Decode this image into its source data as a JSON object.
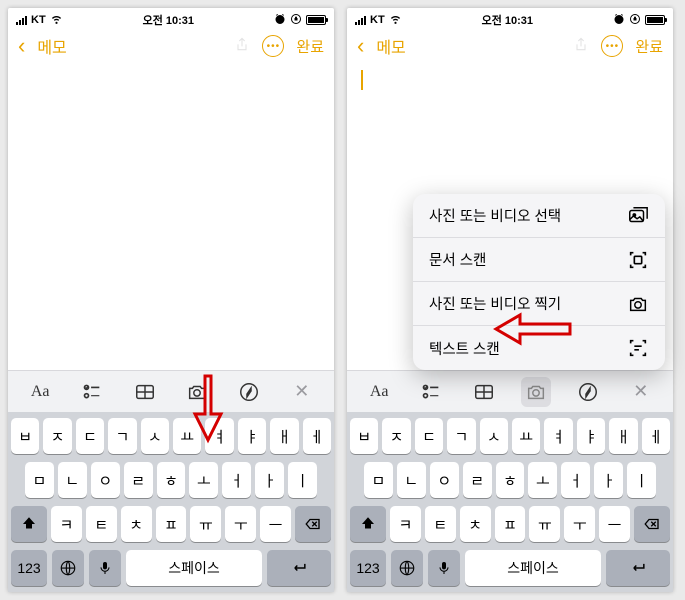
{
  "status": {
    "carrier": "KT",
    "time": "오전 10:31"
  },
  "nav": {
    "back_label": "메모",
    "done_label": "완료"
  },
  "toolbar": {
    "aa": "Aa"
  },
  "popup": {
    "items": [
      {
        "label": "사진 또는 비디오 선택"
      },
      {
        "label": "문서 스캔"
      },
      {
        "label": "사진 또는 비디오 찍기"
      },
      {
        "label": "텍스트 스캔"
      }
    ]
  },
  "keyboard": {
    "row1": [
      "ㅂ",
      "ㅈ",
      "ㄷ",
      "ㄱ",
      "ㅅ",
      "ㅛ",
      "ㅕ",
      "ㅑ",
      "ㅐ",
      "ㅔ"
    ],
    "row2": [
      "ㅁ",
      "ㄴ",
      "ㅇ",
      "ㄹ",
      "ㅎ",
      "ㅗ",
      "ㅓ",
      "ㅏ",
      "ㅣ"
    ],
    "row3": [
      "ㅋ",
      "ㅌ",
      "ㅊ",
      "ㅍ",
      "ㅠ",
      "ㅜ",
      "ㅡ"
    ],
    "num": "123",
    "space": "스페이스"
  }
}
